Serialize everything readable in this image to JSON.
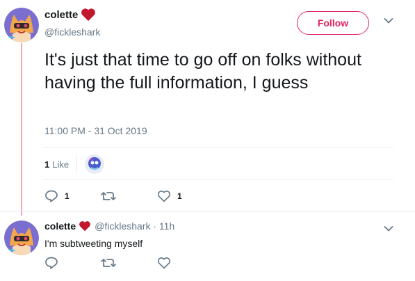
{
  "tweet": {
    "display_name": "colette",
    "handle": "@fickleshark",
    "follow_label": "Follow",
    "text": "It's just that time to go off on folks without having the full information, I guess",
    "timestamp": "11:00 PM - 31 Oct 2019",
    "likes_count": "1",
    "likes_label": "Like",
    "reply_count": "1",
    "like_count": "1"
  },
  "reply": {
    "display_name": "colette",
    "handle_time": "@fickleshark · 11h",
    "text": "I'm subtweeting myself"
  },
  "colors": {
    "accent": "#e0245e",
    "muted": "#657786",
    "thread_line": "#f2a7ab"
  },
  "icons": [
    "heart-icon",
    "chevron-down-icon",
    "reply-icon",
    "retweet-icon",
    "like-icon"
  ]
}
